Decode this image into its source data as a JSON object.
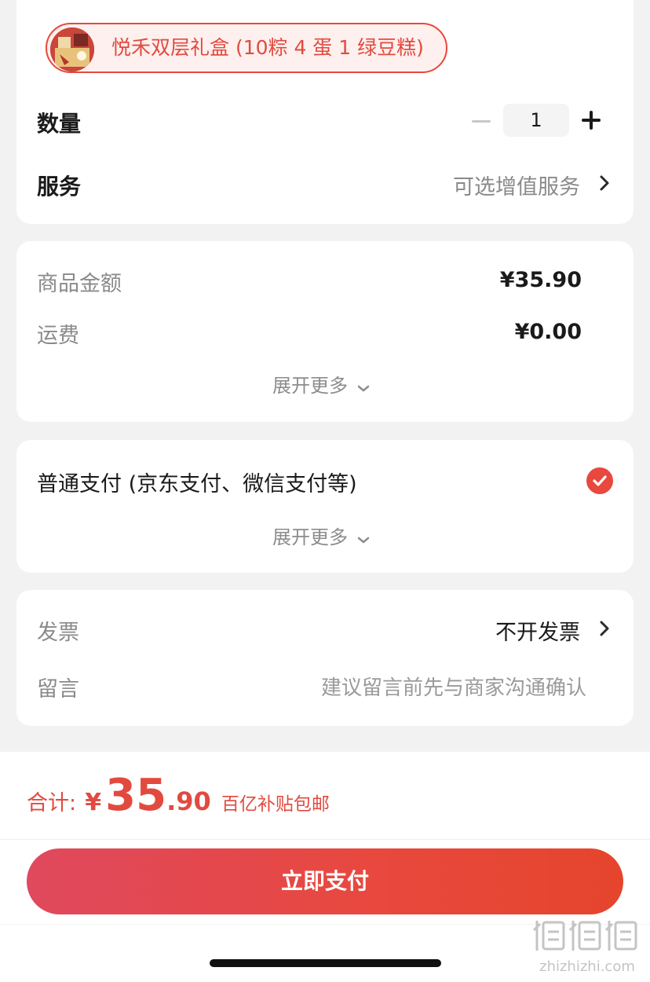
{
  "product": {
    "variant_label": "悦禾双层礼盒 (10粽 4 蛋 1 绿豆糕)"
  },
  "quantity": {
    "label": "数量",
    "value": "1"
  },
  "service": {
    "label": "服务",
    "value": "可选增值服务"
  },
  "price_summary": {
    "goods_label": "商品金额",
    "goods_value": "¥35.90",
    "shipping_label": "运费",
    "shipping_value": "¥0.00",
    "expand_label": "展开更多"
  },
  "payment": {
    "method_label": "普通支付 (京东支付、微信支付等)",
    "expand_label": "展开更多"
  },
  "invoice": {
    "label": "发票",
    "value": "不开发票"
  },
  "message": {
    "label": "留言",
    "placeholder": "建议留言前先与商家沟通确认"
  },
  "footer": {
    "total_label": "合计:",
    "currency": "¥",
    "amount_int": "35",
    "amount_dec": ".90",
    "promo": "百亿补贴包邮",
    "pay_button": "立即支付"
  },
  "watermark": {
    "text": "zhizhizhi.com"
  },
  "colors": {
    "accent": "#e8483d",
    "background": "#f2f2f2",
    "card": "#ffffff"
  },
  "icons": [
    "minus-icon",
    "plus-icon",
    "chevron-right-icon",
    "chevron-down-icon",
    "check-circle-icon"
  ]
}
